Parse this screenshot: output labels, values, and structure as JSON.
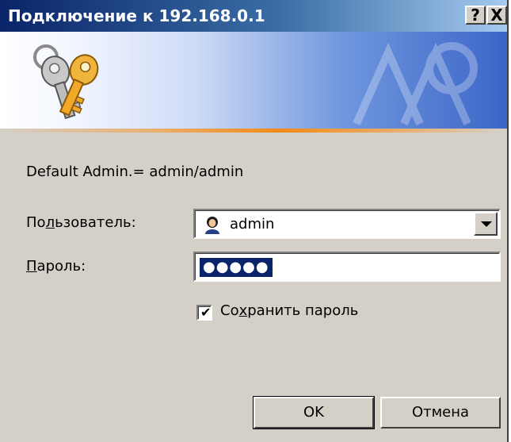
{
  "window": {
    "title": "Подключение к 192.168.0.1",
    "help_label": "?",
    "close_label": "X"
  },
  "banner": {
    "icon": "keys-icon",
    "watermark": "network-watermark-icon"
  },
  "info_text": "Default Admin.= admin/admin",
  "user": {
    "label_prefix": "По",
    "label_accel": "л",
    "label_suffix": "ьзователь:",
    "value": "admin",
    "icon": "user-icon"
  },
  "password": {
    "label_accel": "П",
    "label_suffix": "ароль:",
    "masked_value": "●●●●●"
  },
  "remember": {
    "checked": true,
    "label_prefix": "Со",
    "label_accel": "х",
    "label_suffix": "ранить пароль"
  },
  "buttons": {
    "ok": "OK",
    "cancel": "Отмена"
  },
  "colors": {
    "title_bar": "#0a246a",
    "dialog_bg": "#d4d0c8",
    "selection": "#0a246a",
    "accent_line": "#f38a18"
  }
}
